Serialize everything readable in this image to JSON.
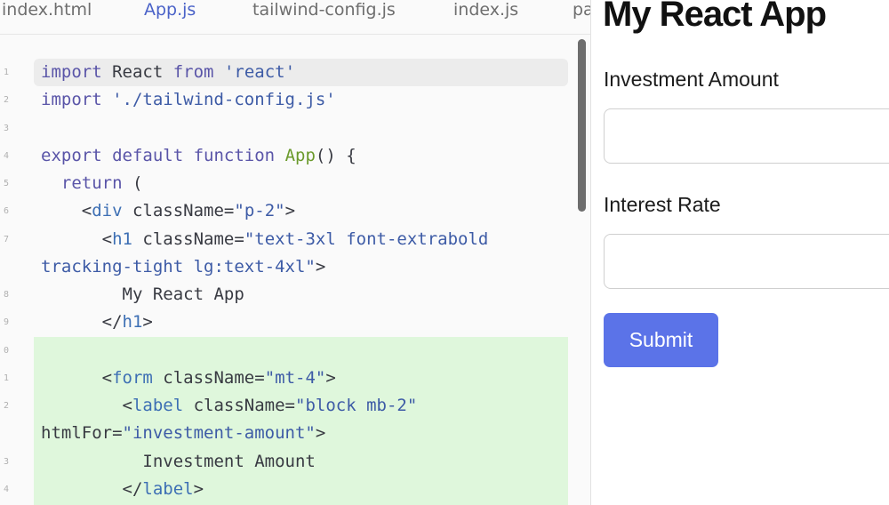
{
  "tabs": [
    {
      "label": "index.html",
      "active": false
    },
    {
      "label": "App.js",
      "active": true
    },
    {
      "label": "tailwind-config.js",
      "active": false
    },
    {
      "label": "index.js",
      "active": false
    },
    {
      "label": "pa",
      "active": false
    }
  ],
  "code_lines": [
    {
      "num": "1",
      "tokens": [
        [
          "kw",
          "import"
        ],
        [
          "pl",
          " React "
        ],
        [
          "kw",
          "from"
        ],
        [
          "pl",
          " "
        ],
        [
          "str",
          "'react'"
        ]
      ]
    },
    {
      "num": "2",
      "tokens": [
        [
          "kw",
          "import"
        ],
        [
          "pl",
          " "
        ],
        [
          "str",
          "'./tailwind-config.js'"
        ]
      ]
    },
    {
      "num": "3",
      "tokens": []
    },
    {
      "num": "4",
      "tokens": [
        [
          "kw",
          "export default function"
        ],
        [
          "pl",
          " "
        ],
        [
          "fn",
          "App"
        ],
        [
          "pl",
          "() {"
        ]
      ]
    },
    {
      "num": "5",
      "tokens": [
        [
          "pl",
          "  "
        ],
        [
          "kw",
          "return"
        ],
        [
          "pl",
          " ("
        ]
      ]
    },
    {
      "num": "6",
      "tokens": [
        [
          "pl",
          "    <"
        ],
        [
          "tag",
          "div"
        ],
        [
          "pl",
          " className="
        ],
        [
          "str",
          "\"p-2\""
        ],
        [
          "pl",
          ">"
        ]
      ]
    },
    {
      "num": "7",
      "tokens": [
        [
          "pl",
          "      <"
        ],
        [
          "tag",
          "h1"
        ],
        [
          "pl",
          " className="
        ],
        [
          "str",
          "\"text-3xl font-extrabold"
        ]
      ]
    },
    {
      "num": "",
      "tokens": [
        [
          "str",
          "tracking-tight lg:text-4xl\""
        ],
        [
          "pl",
          ">"
        ]
      ]
    },
    {
      "num": "8",
      "tokens": [
        [
          "pl",
          "        My React App"
        ]
      ]
    },
    {
      "num": "9",
      "tokens": [
        [
          "pl",
          "      </"
        ],
        [
          "tag",
          "h1"
        ],
        [
          "pl",
          ">"
        ]
      ]
    },
    {
      "num": "0",
      "tokens": []
    },
    {
      "num": "1",
      "tokens": [
        [
          "pl",
          "      <"
        ],
        [
          "tag",
          "form"
        ],
        [
          "pl",
          " className="
        ],
        [
          "str",
          "\"mt-4\""
        ],
        [
          "pl",
          ">"
        ]
      ]
    },
    {
      "num": "2",
      "tokens": [
        [
          "pl",
          "        <"
        ],
        [
          "tag",
          "label"
        ],
        [
          "pl",
          " className="
        ],
        [
          "str",
          "\"block mb-2\""
        ]
      ]
    },
    {
      "num": "",
      "tokens": [
        [
          "pl",
          "htmlFor="
        ],
        [
          "str",
          "\"investment-amount\""
        ],
        [
          "pl",
          ">"
        ]
      ]
    },
    {
      "num": "3",
      "tokens": [
        [
          "pl",
          "          Investment Amount"
        ]
      ]
    },
    {
      "num": "4",
      "tokens": [
        [
          "pl",
          "        </"
        ],
        [
          "tag",
          "label"
        ],
        [
          "pl",
          ">"
        ]
      ]
    }
  ],
  "preview": {
    "title": "My React App",
    "investment_label": "Investment Amount",
    "interest_label": "Interest Rate",
    "submit_label": "Submit"
  },
  "colors": {
    "added_lines_bg": "#dff7dc",
    "button_bg": "#5b73e8",
    "active_tab": "#4a62c8"
  }
}
